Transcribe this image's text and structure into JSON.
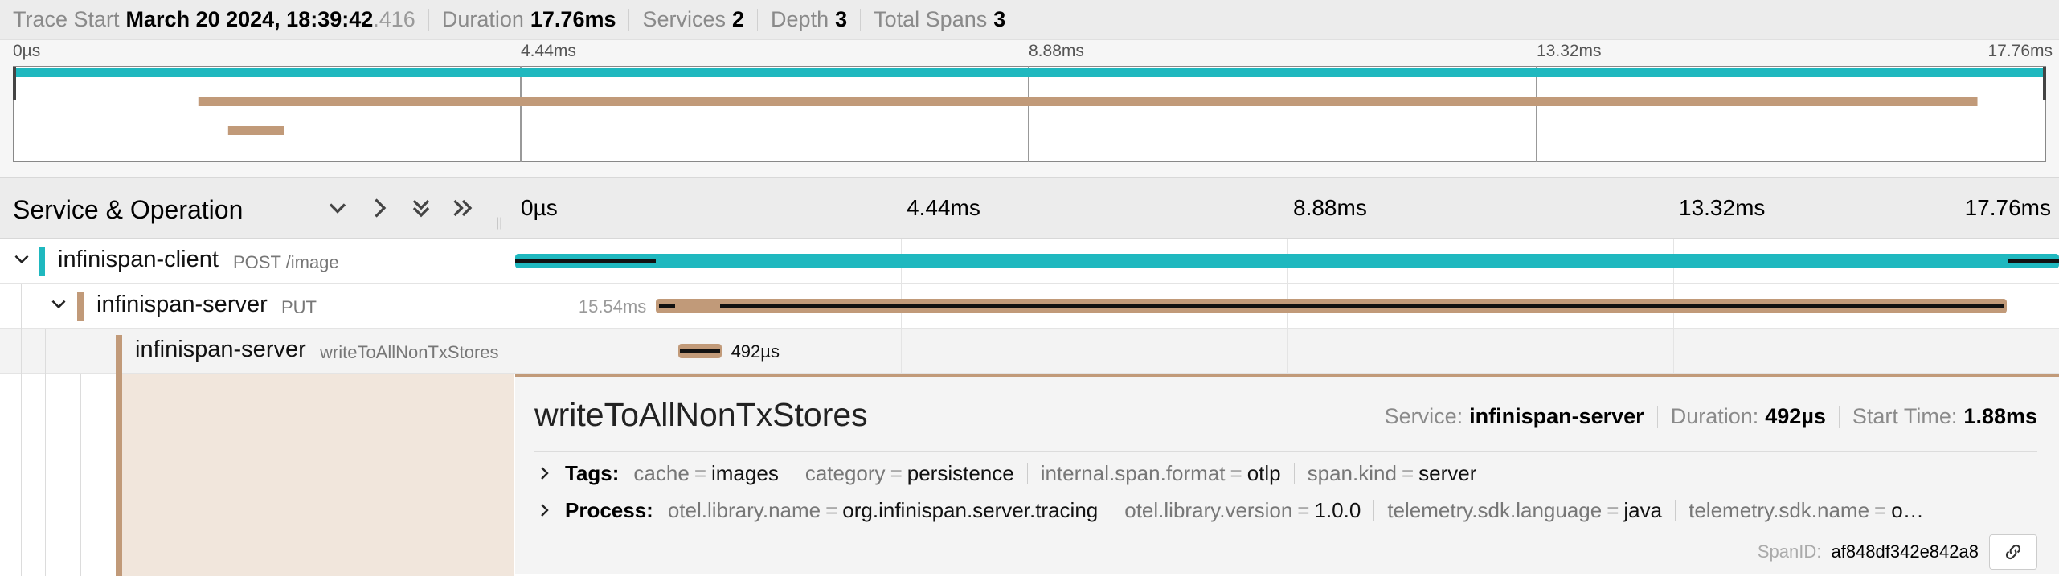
{
  "header": {
    "trace_start_label": "Trace Start",
    "trace_start_value": "March 20 2024, 18:39:42",
    "trace_start_ms": ".416",
    "duration_label": "Duration",
    "duration_value": "17.76ms",
    "services_label": "Services",
    "services_value": "2",
    "depth_label": "Depth",
    "depth_value": "3",
    "total_spans_label": "Total Spans",
    "total_spans_value": "3"
  },
  "minimap": {
    "ticks": [
      "0µs",
      "4.44ms",
      "8.88ms",
      "13.32ms",
      "17.76ms"
    ]
  },
  "timeline_header": {
    "title": "Service & Operation",
    "ticks": [
      "0µs",
      "4.44ms",
      "8.88ms",
      "13.32ms",
      "17.76ms"
    ],
    "controls": [
      "chevron-down-icon",
      "chevron-right-icon",
      "chevrons-down-icon",
      "chevrons-right-icon"
    ]
  },
  "spans": [
    {
      "service": "infinispan-client",
      "operation": "POST /image",
      "color": "#1fb8bf",
      "label": "",
      "start_ms": 0,
      "duration_ms": 17.76
    },
    {
      "service": "infinispan-server",
      "operation": "PUT",
      "color": "#c19a79",
      "label": "15.54ms",
      "start_ms": 1.62,
      "duration_ms": 15.54
    },
    {
      "service": "infinispan-server",
      "operation": "writeToAllNonTxStores",
      "color": "#c19a79",
      "label": "492µs",
      "start_ms": 1.88,
      "duration_ms": 0.492
    }
  ],
  "detail": {
    "title": "writeToAllNonTxStores",
    "service_label": "Service:",
    "service_value": "infinispan-server",
    "duration_label": "Duration:",
    "duration_value": "492µs",
    "start_label": "Start Time:",
    "start_value": "1.88ms",
    "tags_label": "Tags:",
    "tags": [
      {
        "key": "cache",
        "value": "images"
      },
      {
        "key": "category",
        "value": "persistence"
      },
      {
        "key": "internal.span.format",
        "value": "otlp"
      },
      {
        "key": "span.kind",
        "value": "server"
      }
    ],
    "process_label": "Process:",
    "process": [
      {
        "key": "otel.library.name",
        "value": "org.infinispan.server.tracing"
      },
      {
        "key": "otel.library.version",
        "value": "1.0.0"
      },
      {
        "key": "telemetry.sdk.language",
        "value": "java"
      },
      {
        "key": "telemetry.sdk.name",
        "value": "o…"
      }
    ],
    "spanid_label": "SpanID:",
    "spanid_value": "af848df342e842a8"
  }
}
